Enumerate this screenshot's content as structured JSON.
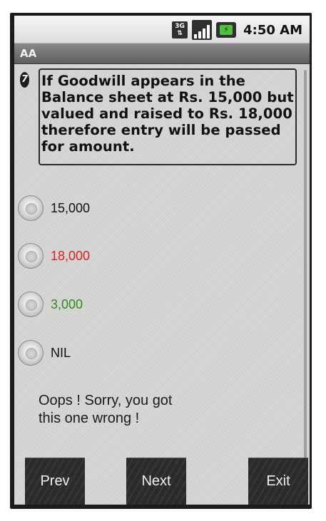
{
  "status_bar": {
    "network": "3G",
    "time": "4:50 AM",
    "icons": [
      "3g-data-icon",
      "signal-strength-icon",
      "battery-charging-icon"
    ]
  },
  "app": {
    "title": "AA"
  },
  "question": {
    "number": "7",
    "text": "If Goodwill appears in the Balance sheet at Rs. 15,000 but valued and raised to Rs. 18,000 therefore entry will be passed for  amount."
  },
  "options": [
    {
      "label": "15,000",
      "color": "#111111"
    },
    {
      "label": "18,000",
      "color": "#e02020"
    },
    {
      "label": "3,000",
      "color": "#2e8b1f"
    },
    {
      "label": "NIL",
      "color": "#111111"
    }
  ],
  "feedback": {
    "text": "Oops ! Sorry, you got\nthis one wrong !"
  },
  "buttons": {
    "prev": "Prev",
    "next": "Next",
    "exit": "Exit"
  }
}
